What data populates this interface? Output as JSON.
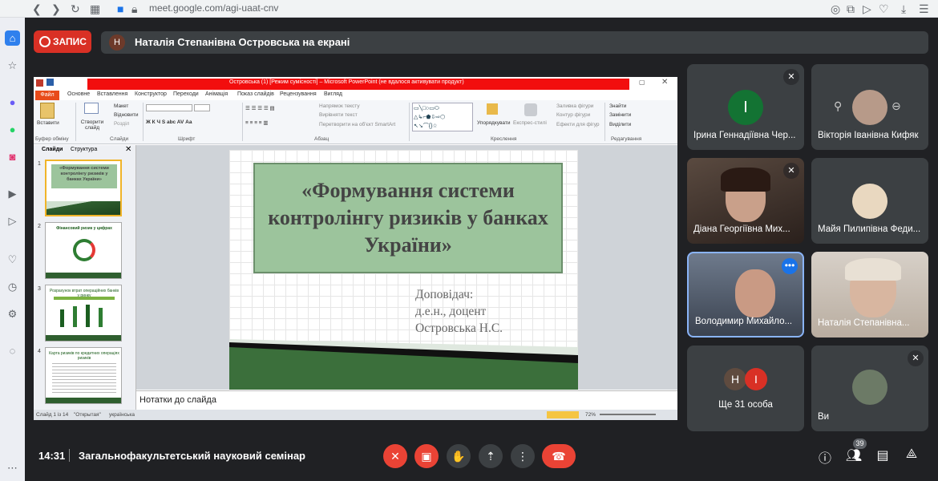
{
  "browser": {
    "url": "meet.google.com/agi-uaat-cnv"
  },
  "meet": {
    "record_label": "ЗАПИС",
    "presenter_initial": "Н",
    "presenter_text": "Наталія Степанівна Островська на екрані",
    "time": "14:31",
    "meeting_title": "Загальнофакультетський науковий семінар",
    "participant_count": "39"
  },
  "ppt": {
    "title_bar": "Островська (1) [Режим сумісності] – Microsoft PowerPoint (не вдалося активувати продукт)",
    "tabs": [
      "Файл",
      "Основне",
      "Вставлення",
      "Конструктор",
      "Переходи",
      "Анімація",
      "Показ слайдів",
      "Рецензування",
      "Вигляд"
    ],
    "ribbon": {
      "paste": "Вставити",
      "create_slide": "Створити слайд",
      "layout": "Макет",
      "reset": "Відновити",
      "section": "Розділ",
      "text_direction": "Напрямок тексту",
      "align_text": "Вирівняти текст",
      "smartart": "Перетворити на об'єкт SmartArt",
      "arrange": "Упорядкувати",
      "quick_styles": "Експрес-стилі",
      "shape_fill": "Заливка фігури",
      "shape_outline": "Контур фігури",
      "shape_effects": "Ефекти для фігур",
      "find": "Знайти",
      "replace": "Замінити",
      "select": "Виділити",
      "groups": [
        "Буфер обміну",
        "Слайди",
        "Шрифт",
        "Абзац",
        "Креслення",
        "Редагування"
      ]
    },
    "panel_tabs": [
      "Слайди",
      "Структура"
    ],
    "slide_title": "«Формування системи контролінгу ризиків у банках України»",
    "slide_sub1": "Доповідач:",
    "slide_sub2": "д.е.н., доцент",
    "slide_sub3": "Островська Н.С.",
    "thumb1_title": "«Формування системи контролінгу ризиків у банках України»",
    "thumb2_title": "Фінансовий ризик у цифрах",
    "thumb3_title": "Розрахунок втрат операційних банків у ринку",
    "thumb4_title": "Карта ризиків по кредитних операціях ризиків",
    "notes": "Нотатки до слайда",
    "status_left": "Слайд 1 із 14",
    "status_theme": "\"Открытая\"",
    "status_lang": "українська",
    "zoom": "72%"
  },
  "tiles": [
    {
      "name": "Ірина Геннадіївна Чер...",
      "initial": "І",
      "color": "#137333"
    },
    {
      "name": "Вікторія Іванівна Кифяк"
    },
    {
      "name": "Діана Георгіївна Мих..."
    },
    {
      "name": "Майя Пилипівна Феди..."
    },
    {
      "name": "Володимир Михайло..."
    },
    {
      "name": "Наталія Степанівна..."
    },
    {
      "name": "Ще 31 особа",
      "i1": "Н",
      "i2": "І"
    },
    {
      "name": "Ви"
    }
  ]
}
